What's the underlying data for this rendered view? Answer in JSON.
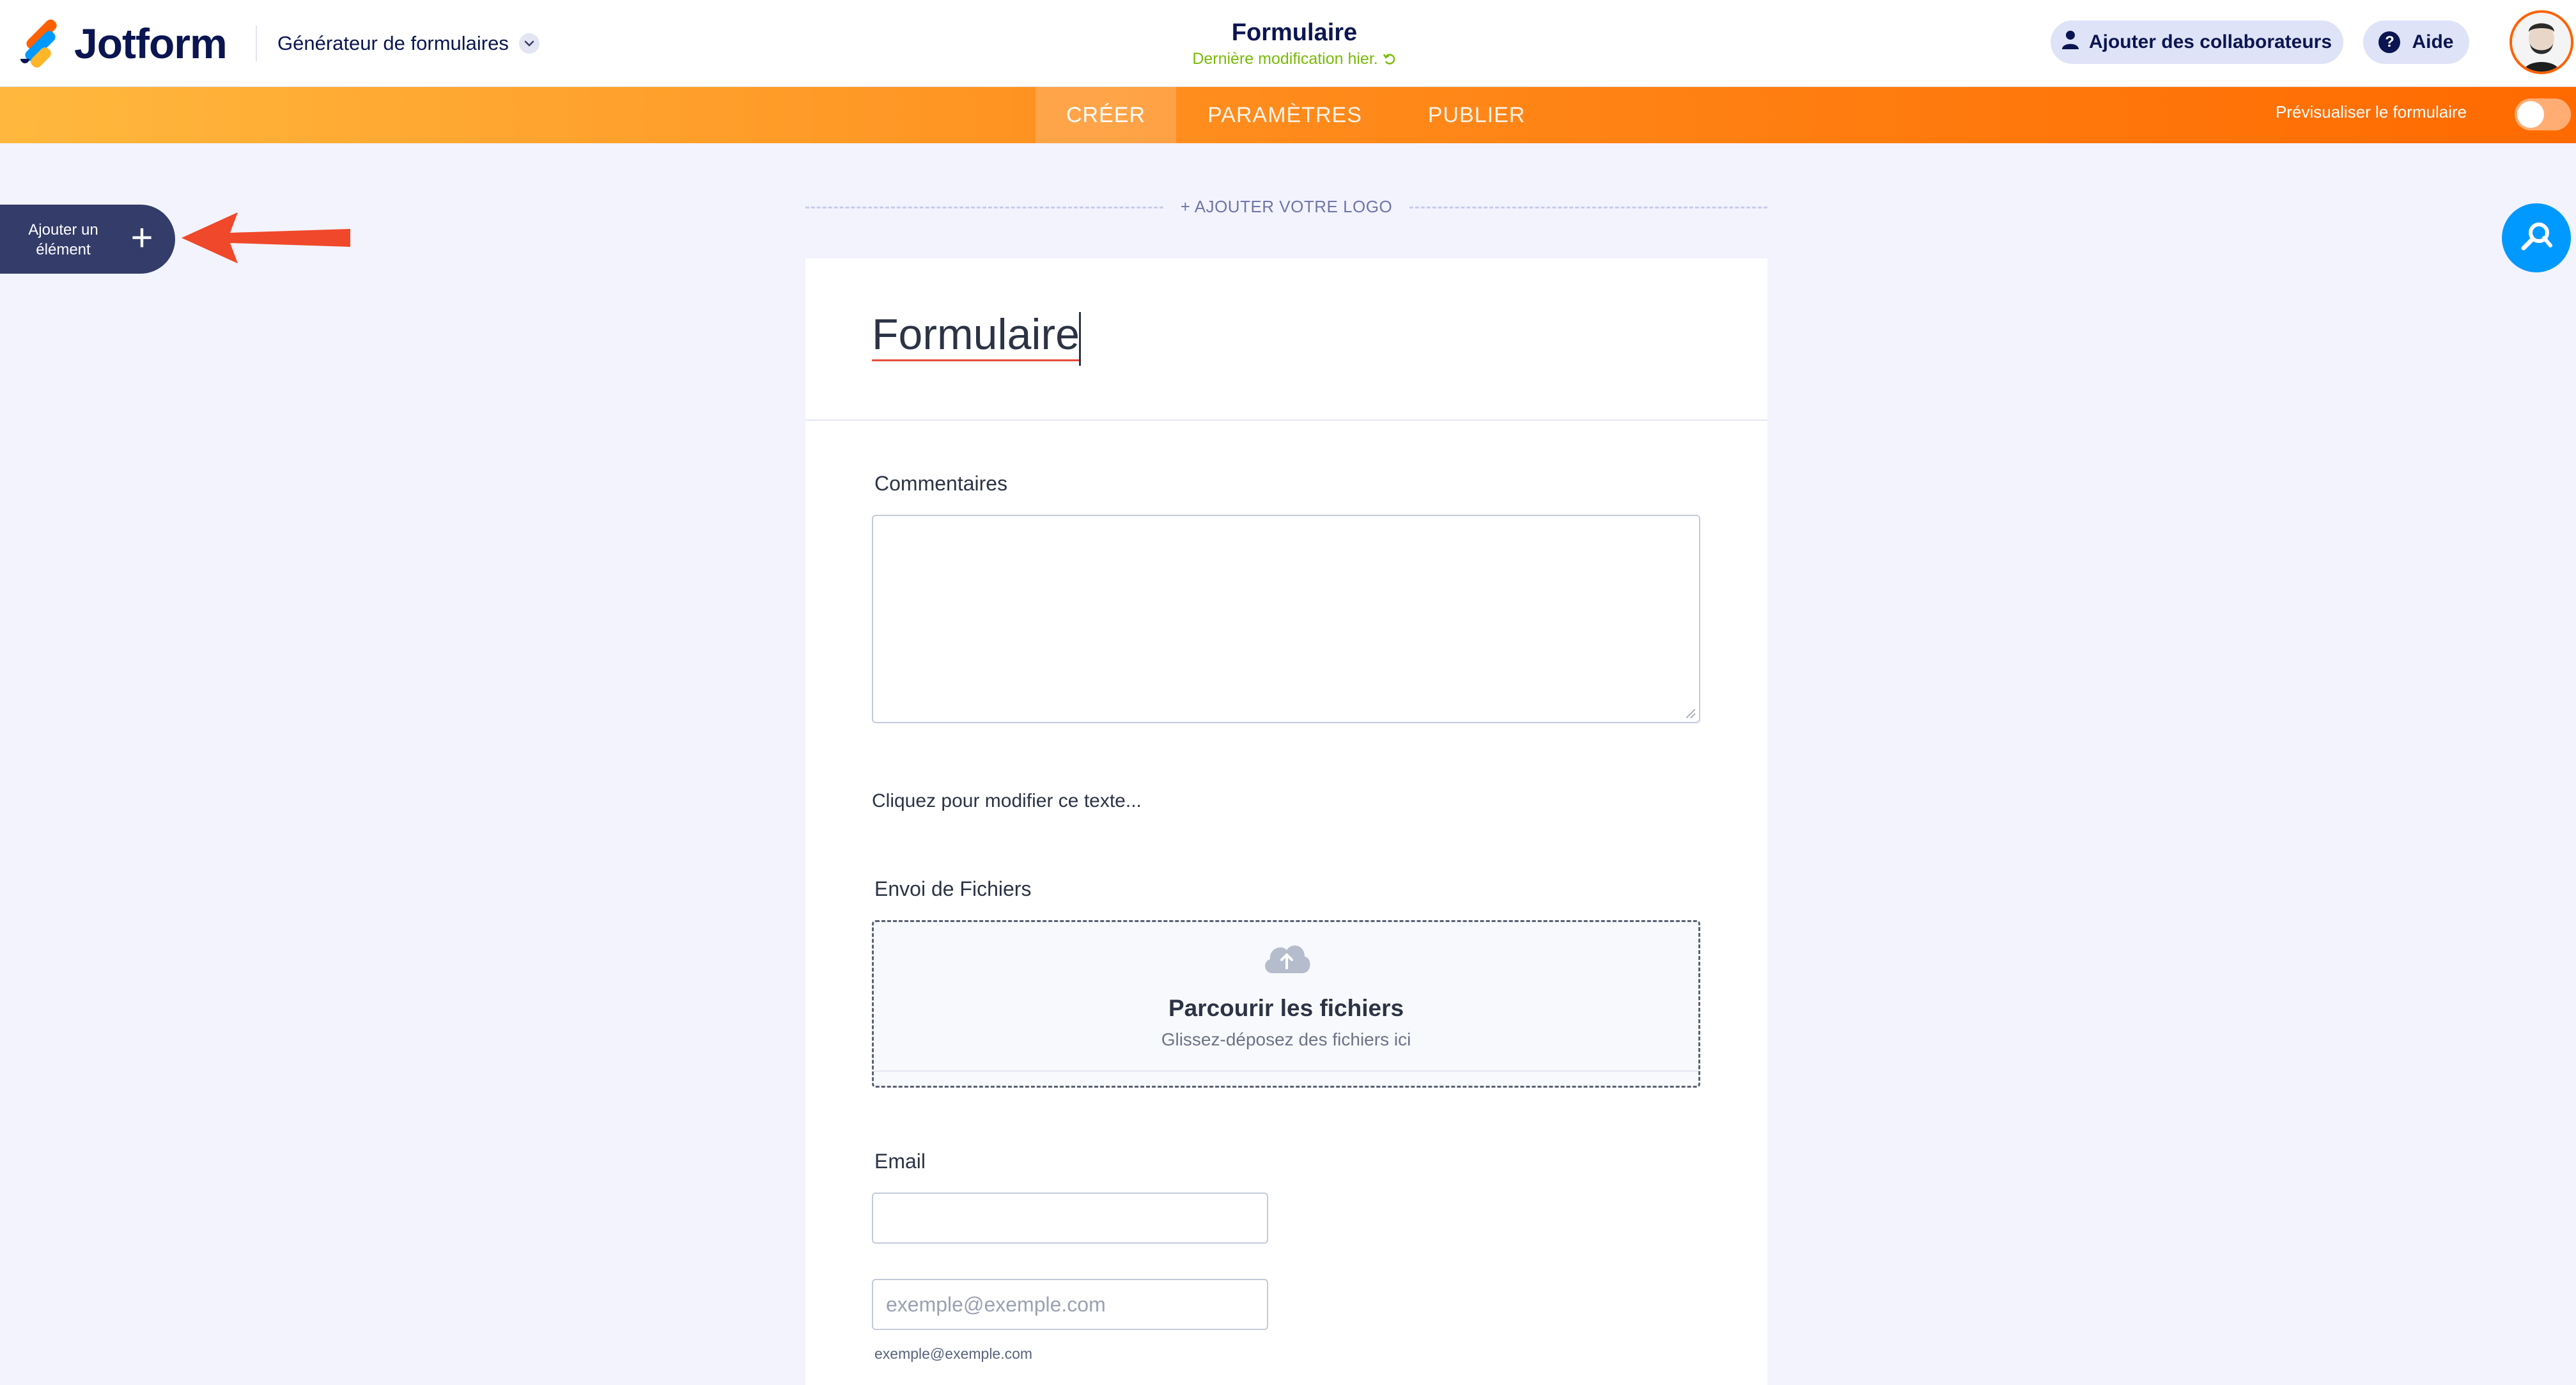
{
  "header": {
    "brand": "Jotform",
    "builder_menu": "Générateur de formulaires",
    "form_title": "Formulaire",
    "last_modified": "Dernière modification hier.",
    "add_collaborators": "Ajouter des collaborateurs",
    "help": "Aide"
  },
  "nav": {
    "tabs": [
      "CRÉER",
      "PARAMÈTRES",
      "PUBLIER"
    ],
    "active_tab": "CRÉER",
    "preview_label": "Prévisualiser le formulaire",
    "preview_on": false
  },
  "sidebar": {
    "add_element": "Ajouter un élément"
  },
  "canvas": {
    "add_logo": "+ AJOUTER VOTRE LOGO"
  },
  "form": {
    "title": "Formulaire",
    "comments_label": "Commentaires",
    "paragraph_text": "Cliquez pour modifier ce texte...",
    "file_upload_label": "Envoi de Fichiers",
    "file_browse": "Parcourir les fichiers",
    "file_drop": "Glissez-déposez des fichiers ici",
    "email_label": "Email",
    "email_confirm_placeholder": "exemple@exemple.com",
    "email_sublabel": "exemple@exemple.com"
  },
  "colors": {
    "brand_orange": "#ff6100",
    "brand_blue": "#0099ff",
    "navy": "#0a1551",
    "accent_green": "#78bb07",
    "annotation_red": "#f0482a"
  },
  "icons": [
    "jotform-logo-icon",
    "chevron-down-icon",
    "refresh-icon",
    "user-icon",
    "help-icon",
    "plus-icon",
    "arrow-icon",
    "magic-wand-icon",
    "cloud-upload-icon"
  ]
}
